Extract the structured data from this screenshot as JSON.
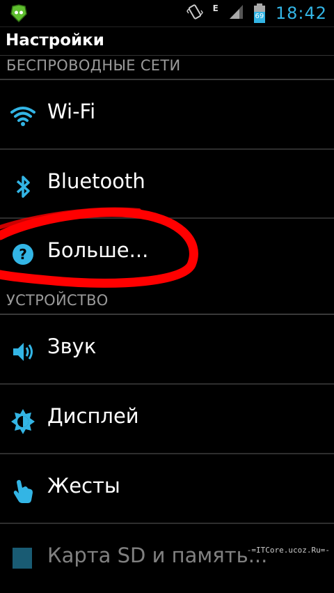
{
  "status_bar": {
    "time": "18:42",
    "network_type": "E",
    "battery_level": "69",
    "icons": [
      "app-icon",
      "vibrate-icon",
      "signal-icon",
      "battery-icon"
    ]
  },
  "action_bar": {
    "title": "Настройки"
  },
  "sections": [
    {
      "header": "БЕСПРОВОДНЫЕ СЕТИ",
      "items": [
        {
          "label": "Wi-Fi",
          "icon": "wifi-icon"
        },
        {
          "label": "Bluetooth",
          "icon": "bluetooth-icon"
        },
        {
          "label": "Больше...",
          "icon": "help-icon"
        }
      ]
    },
    {
      "header": "УСТРОЙСТВО",
      "items": [
        {
          "label": "Звук",
          "icon": "speaker-icon"
        },
        {
          "label": "Дисплей",
          "icon": "brightness-icon"
        },
        {
          "label": "Жесты",
          "icon": "gesture-hand-icon"
        },
        {
          "label": "Карта SD и память...",
          "icon": "storage-icon"
        }
      ]
    }
  ],
  "watermark": "-=ITCore.ucoz.Ru=-",
  "colors": {
    "accent": "#33b5e5",
    "annotation": "#ff0000",
    "header_text": "#9a9a9a"
  }
}
